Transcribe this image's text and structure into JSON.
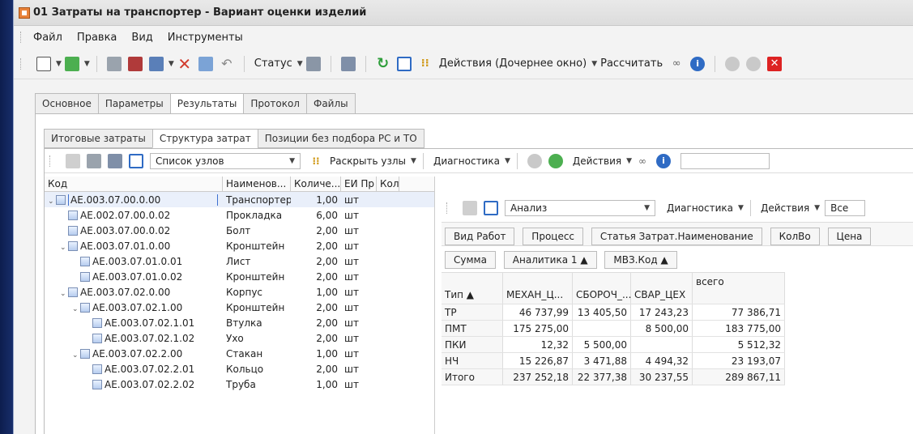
{
  "window": {
    "title": "01 Затраты на транспортер - Вариант оценки изделий"
  },
  "menu": [
    "Файл",
    "Правка",
    "Вид",
    "Инструменты"
  ],
  "toolbar": {
    "status": "Статус",
    "actions": "Действия (Дочернее окно)",
    "calculate": "Рассчитать"
  },
  "tabs": [
    "Основное",
    "Параметры",
    "Результаты",
    "Протокол",
    "Файлы"
  ],
  "subtabs": [
    "Итоговые затраты",
    "Структура затрат",
    "Позиции без подбора РС и ТО"
  ],
  "left_toolbar": {
    "list_combo": "Список узлов",
    "expand": "Раскрыть узлы",
    "diagnostics": "Диагностика",
    "actions": "Действия"
  },
  "tree": {
    "headers": [
      "Код",
      "Наименов...",
      "Количе...",
      "ЕИ Пр",
      "Кол"
    ],
    "rows": [
      {
        "code": "AE.003.07.00.0.00",
        "name": "Транспортер",
        "qty": "1,00",
        "unit": "шт"
      },
      {
        "code": "AE.002.07.00.0.02",
        "name": "Прокладка",
        "qty": "6,00",
        "unit": "шт"
      },
      {
        "code": "AE.003.07.00.0.02",
        "name": "Болт",
        "qty": "2,00",
        "unit": "шт"
      },
      {
        "code": "AE.003.07.01.0.00",
        "name": "Кронштейн",
        "qty": "2,00",
        "unit": "шт"
      },
      {
        "code": "AE.003.07.01.0.01",
        "name": "Лист",
        "qty": "2,00",
        "unit": "шт"
      },
      {
        "code": "AE.003.07.01.0.02",
        "name": "Кронштейн",
        "qty": "2,00",
        "unit": "шт"
      },
      {
        "code": "AE.003.07.02.0.00",
        "name": "Корпус",
        "qty": "1,00",
        "unit": "шт"
      },
      {
        "code": "AE.003.07.02.1.00",
        "name": "Кронштейн",
        "qty": "2,00",
        "unit": "шт"
      },
      {
        "code": "AE.003.07.02.1.01",
        "name": "Втулка",
        "qty": "2,00",
        "unit": "шт"
      },
      {
        "code": "AE.003.07.02.1.02",
        "name": "Ухо",
        "qty": "2,00",
        "unit": "шт"
      },
      {
        "code": "AE.003.07.02.2.00",
        "name": "Стакан",
        "qty": "1,00",
        "unit": "шт"
      },
      {
        "code": "AE.003.07.02.2.01",
        "name": "Кольцо",
        "qty": "2,00",
        "unit": "шт"
      },
      {
        "code": "AE.003.07.02.2.02",
        "name": "Труба",
        "qty": "1,00",
        "unit": "шт"
      }
    ]
  },
  "right_toolbar": {
    "combo": "Анализ",
    "diagnostics": "Диагностика",
    "actions": "Действия",
    "filter": "Все"
  },
  "field_buttons": [
    "Вид Работ",
    "Процесс",
    "Статья Затрат.Наименование",
    "КолВо",
    "Цена"
  ],
  "data_fields": [
    "Сумма",
    "Аналитика 1 ▲",
    "МВЗ.Код ▲"
  ],
  "pivot": {
    "row_header": "Тип ▲",
    "columns": [
      "МЕХАН_Ц...",
      "СБОРОЧ_...",
      "СВАР_ЦЕХ",
      "всего"
    ],
    "rows": [
      {
        "label": "ТР",
        "v": [
          "46 737,99",
          "13 405,50",
          "17 243,23",
          "77 386,71"
        ]
      },
      {
        "label": "ПМТ",
        "v": [
          "175 275,00",
          "",
          "8 500,00",
          "183 775,00"
        ]
      },
      {
        "label": "ПКИ",
        "v": [
          "12,32",
          "5 500,00",
          "",
          "5 512,32"
        ]
      },
      {
        "label": "НЧ",
        "v": [
          "15 226,87",
          "3 471,88",
          "4 494,32",
          "23 193,07"
        ]
      },
      {
        "label": "Итого",
        "v": [
          "237 252,18",
          "22 377,38",
          "30 237,55",
          "289 867,11"
        ]
      }
    ]
  }
}
